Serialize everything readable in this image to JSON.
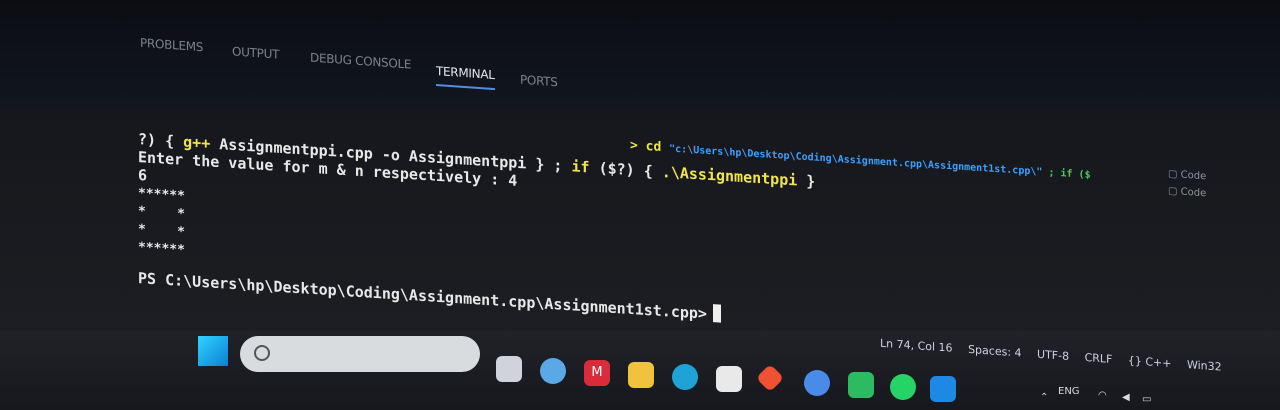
{
  "panel": {
    "tabs": [
      "PROBLEMS",
      "OUTPUT",
      "DEBUG CONSOLE",
      "TERMINAL",
      "PORTS"
    ],
    "active_tab": "TERMINAL"
  },
  "terminal": {
    "line1": {
      "prefix": "?) { ",
      "compiler": "g++",
      "text": " Assignmentppi.cpp -o Assignmentppi } ; ",
      "if1": "if",
      "cond": " ($?) { ",
      "exe": ".\\Assignmentppi",
      "end": " }"
    },
    "cd_cmd": {
      "arrow": "> cd",
      "path": "\"c:\\Users\\hp\\Desktop\\Coding\\Assignment.cpp\\Assignment1st.cpp\\\"",
      "tail": " ; if ($"
    },
    "line2": "Enter the value for m & n respectively : 4",
    "line3": "6",
    "pattern": [
      "******",
      "*    *",
      "*    *",
      "******"
    ],
    "prompt": "PS C:\\Users\\hp\\Desktop\\Coding\\Assignment.cpp\\Assignment1st.cpp>"
  },
  "side_actions": [
    "Code",
    "Code"
  ],
  "statusbar": {
    "position": "Ln 74, Col 16",
    "spaces": "Spaces: 4",
    "encoding": "UTF-8",
    "eol": "CRLF",
    "lang": "{} C++",
    "platform": "Win32"
  },
  "taskbar": {
    "tray_lang": "ENG",
    "icons": [
      "taskview-icon",
      "chat-icon",
      "mcafee-icon",
      "file-explorer-icon",
      "edge-icon",
      "store-icon",
      "git-icon",
      "chrome-icon",
      "drive-icon",
      "whatsapp-icon",
      "vscode-icon"
    ]
  }
}
